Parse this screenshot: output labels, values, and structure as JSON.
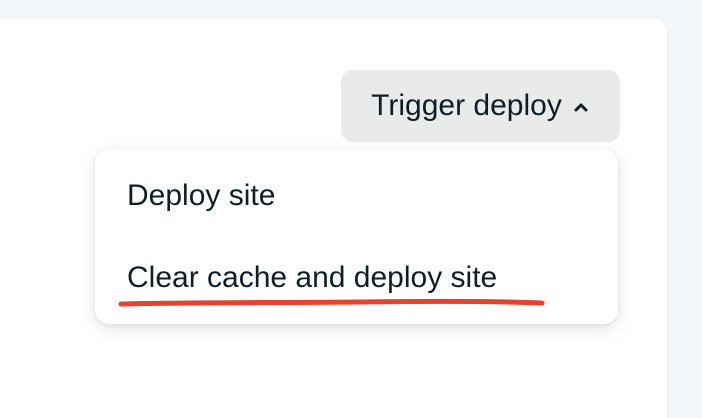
{
  "trigger": {
    "label": "Trigger deploy",
    "icon": "chevron-up-icon"
  },
  "menu": {
    "items": [
      {
        "label": "Deploy site"
      },
      {
        "label": "Clear cache and deploy site"
      }
    ]
  },
  "colors": {
    "text": "#0e1e25",
    "button_bg": "#e9ebeb",
    "annotation": "#e8412c",
    "page_bg": "#f3f6f8"
  }
}
